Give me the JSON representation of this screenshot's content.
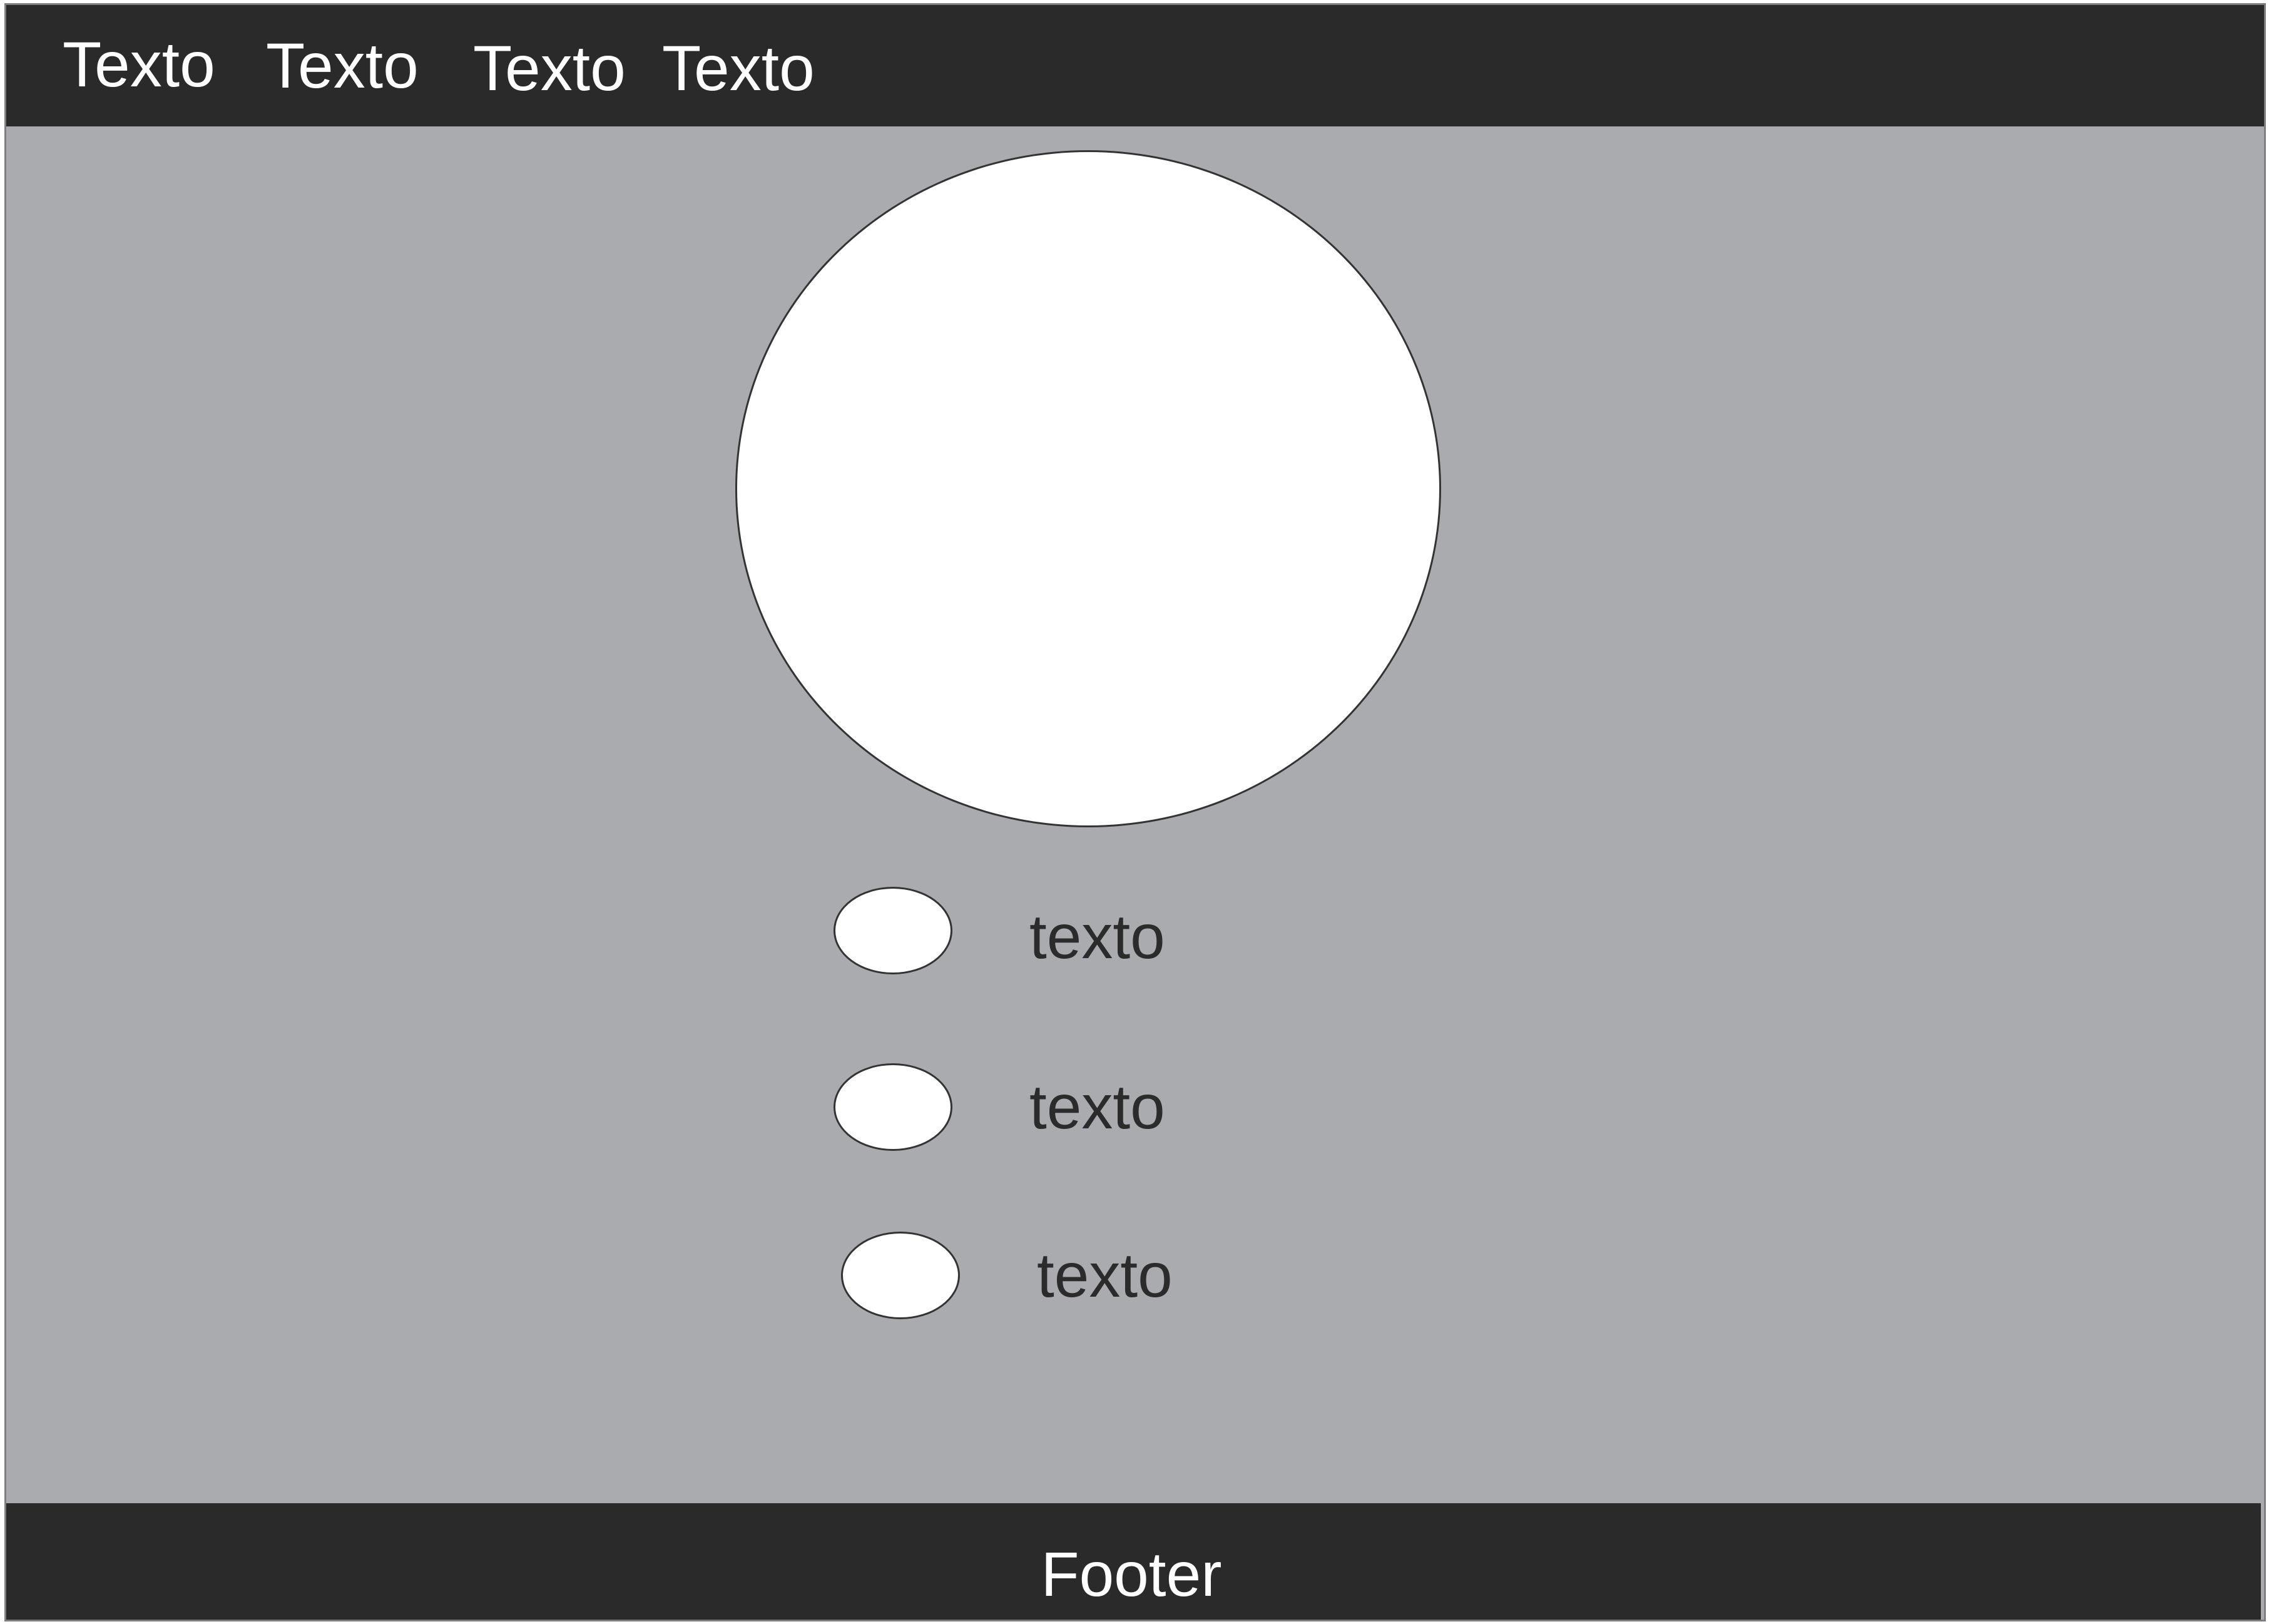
{
  "colors": {
    "bar_background": "#2a2a2a",
    "page_background": "#aaabae",
    "nav_text": "#ffffff",
    "body_text": "#2b2b2b",
    "shape_fill": "#ffffff"
  },
  "nav": {
    "items": [
      {
        "label": "Texto"
      },
      {
        "label": "Texto"
      },
      {
        "label": "Texto"
      },
      {
        "label": "Texto"
      }
    ]
  },
  "main": {
    "list": [
      {
        "label": "texto"
      },
      {
        "label": "texto"
      },
      {
        "label": "texto"
      }
    ]
  },
  "footer": {
    "label": "Footer"
  }
}
